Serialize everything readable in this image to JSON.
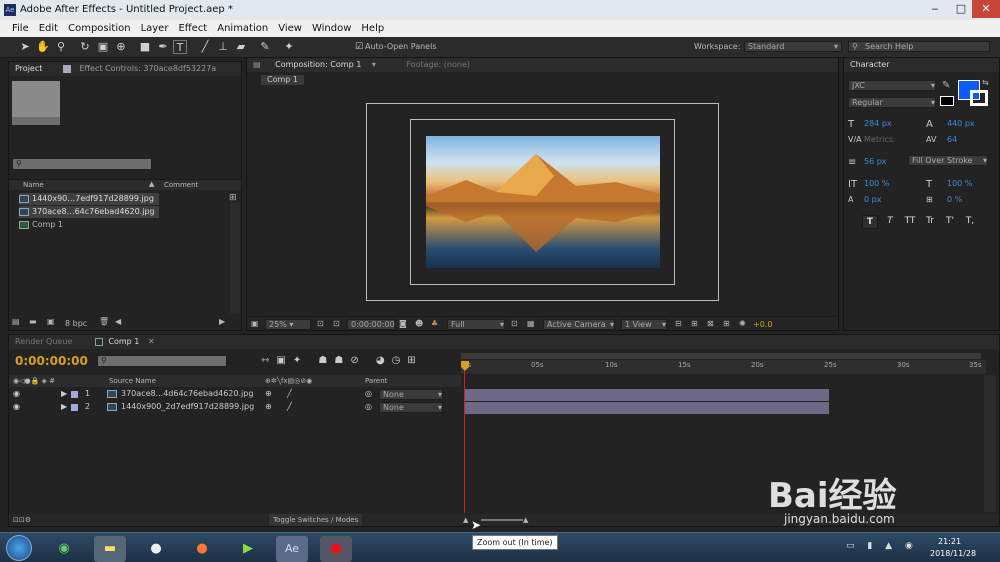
{
  "window": {
    "title": "Adobe After Effects - Untitled Project.aep *"
  },
  "menu": [
    "File",
    "Edit",
    "Composition",
    "Layer",
    "Effect",
    "Animation",
    "View",
    "Window",
    "Help"
  ],
  "toolbar": {
    "auto_open": "Auto-Open Panels",
    "workspace_label": "Workspace:",
    "workspace_value": "Standard",
    "search_help": "Search Help"
  },
  "project": {
    "tab_project": "Project",
    "tab_effect": "Effect Controls: 370ace8df53227a",
    "col_name": "Name",
    "col_comment": "Comment",
    "items": [
      "1440x90…7edf917d28899.jpg",
      "370ace8…64c76ebad4620.jpg",
      "Comp 1"
    ],
    "bpc": "8 bpc"
  },
  "comp": {
    "tab_comp": "Composition: Comp 1",
    "tab_footage": "Footage: (none)",
    "breadcrumb": "Comp 1",
    "zoom": "25%",
    "timecode": "0:00:00:00",
    "resolution": "Full",
    "camera": "Active Camera",
    "view": "1 View",
    "exposure": "+0.0"
  },
  "character": {
    "title": "Character",
    "font": "JXC",
    "style": "Regular",
    "size": "284 px",
    "leading": "440 px",
    "kerning": "Metrics",
    "tracking": "64",
    "stroke_width": "56 px",
    "stroke_type": "Fill Over Stroke",
    "vscale": "100 %",
    "hscale": "100 %",
    "baseline": "0 px",
    "tsume": "0 %",
    "fill_color": "#0a5cff",
    "formats": [
      "T",
      "T",
      "TT",
      "Tr",
      "T'",
      "T,"
    ]
  },
  "timeline": {
    "tab_render": "Render Queue",
    "tab_comp": "Comp 1",
    "timecode": "0:00:00:00",
    "col_source": "Source Name",
    "col_parent": "Parent",
    "ruler": [
      "0s",
      "05s",
      "10s",
      "15s",
      "20s",
      "25s",
      "30s",
      "35s"
    ],
    "layers": [
      {
        "num": "1",
        "name": "370ace8...4d64c76ebad4620.jpg",
        "parent": "None"
      },
      {
        "num": "2",
        "name": "1440x900_2d7edf917d28899.jpg",
        "parent": "None"
      }
    ],
    "toggle": "Toggle Switches / Modes",
    "tooltip": "Zoom out (In time)"
  },
  "taskbar": {
    "time": "21:21",
    "date": "2018/11/28"
  },
  "watermark": {
    "brand": "Bai经验",
    "url": "jingyan.baidu.com"
  }
}
